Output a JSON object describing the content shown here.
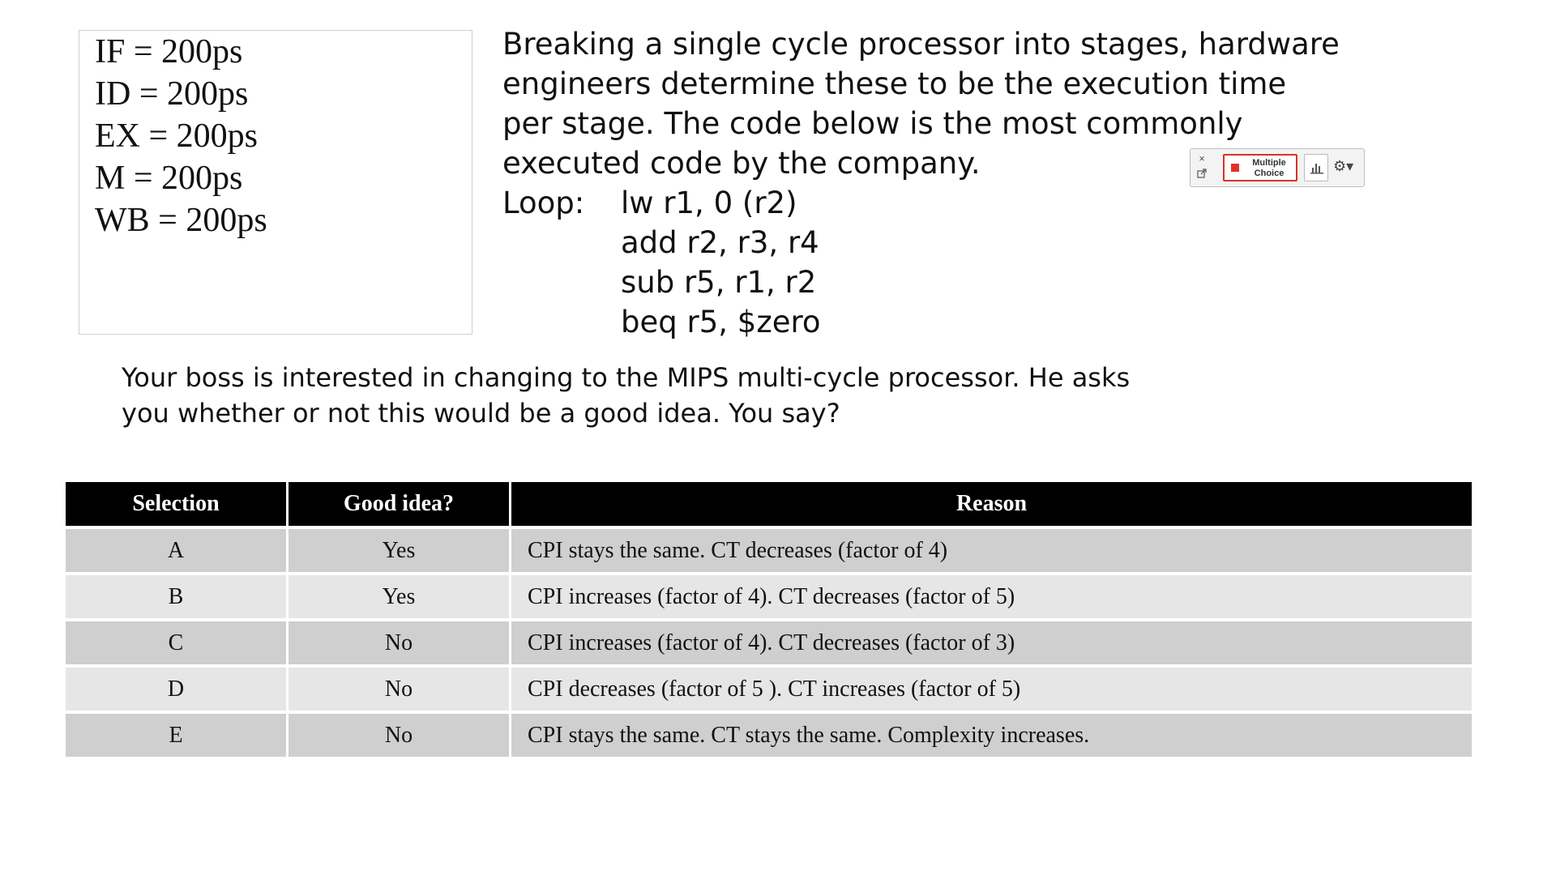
{
  "stages": [
    {
      "text": "IF = 200ps"
    },
    {
      "text": "ID = 200ps"
    },
    {
      "text": "EX = 200ps"
    },
    {
      "text": "M = 200ps"
    },
    {
      "text": "WB = 200ps"
    }
  ],
  "intro_lines": [
    "Breaking a single cycle processor into stages, hardware",
    "engineers determine these to be the execution time",
    "per stage.  The code below is the most commonly",
    "executed code by the company."
  ],
  "code": [
    {
      "label": "Loop:",
      "instr": "lw r1, 0 (r2)"
    },
    {
      "label": "",
      "instr": "add r2, r3, r4"
    },
    {
      "label": "",
      "instr": "sub r5, r1, r2"
    },
    {
      "label": "",
      "instr": "beq r5, $zero"
    }
  ],
  "question_lines": [
    "Your boss is interested in changing to the MIPS multi-cycle processor.  He asks",
    "you whether or not this would be a good idea.  You say?"
  ],
  "poll_toolbar": {
    "close_glyph": "×",
    "multiple_choice_line1": "Multiple",
    "multiple_choice_line2": "Choice",
    "accent_color": "#e0312a"
  },
  "table": {
    "headers": [
      "Selection",
      "Good idea?",
      "Reason"
    ],
    "rows": [
      [
        "A",
        "Yes",
        "CPI stays the same.  CT decreases (factor of 4)"
      ],
      [
        "B",
        "Yes",
        "CPI increases (factor of 4). CT decreases (factor of 5)"
      ],
      [
        "C",
        "No",
        "CPI increases (factor of 4). CT decreases (factor of 3)"
      ],
      [
        "D",
        "No",
        "CPI decreases (factor of 5 ). CT increases  (factor of 5)"
      ],
      [
        "E",
        "No",
        "CPI stays the same. CT stays the same. Complexity increases."
      ]
    ]
  }
}
